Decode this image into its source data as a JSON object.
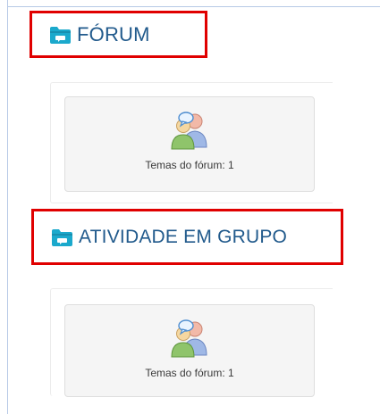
{
  "sections": [
    {
      "title": "FÓRUM",
      "icon": "folder-chat-icon",
      "tile": {
        "icon": "forum-users-icon",
        "caption": "Temas do fórum: 1"
      }
    },
    {
      "title": "ATIVIDADE EM GRUPO",
      "icon": "folder-chat-icon",
      "tile": {
        "icon": "forum-users-icon",
        "caption": "Temas do fórum: 1"
      }
    }
  ],
  "colors": {
    "title": "#215a8c",
    "highlight_border": "#e00000",
    "folder": "#1ba9cc",
    "tile_background": "#f5f5f5"
  }
}
